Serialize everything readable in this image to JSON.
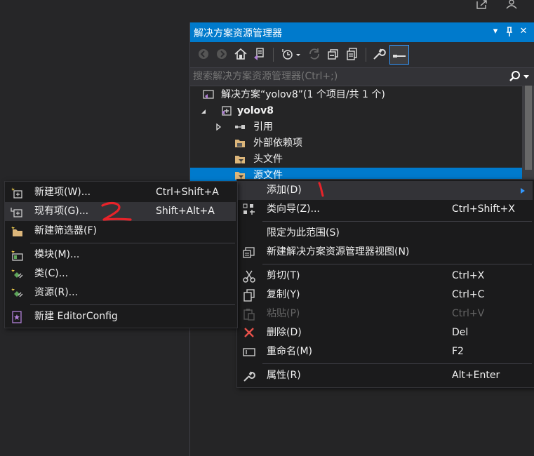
{
  "solution_explorer": {
    "title": "解决方案资源管理器",
    "title_buttons": [
      "▾",
      "⊥",
      "✕"
    ],
    "search_placeholder": "搜索解决方案资源管理器(Ctrl+;)",
    "tree": {
      "solution": "解决方案“yolov8”(1 个项目/共 1 个)",
      "project": "yolov8",
      "references": "引用",
      "external_deps": "外部依赖项",
      "header_files": "头文件",
      "source_files": "源文件"
    }
  },
  "context_menu": {
    "items": [
      {
        "label": "添加(D)",
        "shortcut": "",
        "icon": "none",
        "highlighted": true,
        "disabled": false,
        "has_submenu": true
      },
      {
        "label": "类向导(Z)...",
        "shortcut": "Ctrl+Shift+X",
        "icon": "class-wizard-icon",
        "disabled": false
      },
      {
        "label": "限定为此范围(S)",
        "shortcut": "",
        "icon": "none",
        "disabled": false
      },
      {
        "label": "新建解决方案资源管理器视图(N)",
        "shortcut": "",
        "icon": "new-view-icon",
        "disabled": false
      },
      {
        "label": "剪切(T)",
        "shortcut": "Ctrl+X",
        "icon": "scissors-icon",
        "disabled": false
      },
      {
        "label": "复制(Y)",
        "shortcut": "Ctrl+C",
        "icon": "copy-icon",
        "disabled": false
      },
      {
        "label": "粘贴(P)",
        "shortcut": "Ctrl+V",
        "icon": "paste-icon",
        "disabled": true
      },
      {
        "label": "删除(D)",
        "shortcut": "Del",
        "icon": "delete-icon",
        "disabled": false
      },
      {
        "label": "重命名(M)",
        "shortcut": "F2",
        "icon": "rename-icon",
        "disabled": false
      },
      {
        "label": "属性(R)",
        "shortcut": "Alt+Enter",
        "icon": "wrench-icon",
        "disabled": false
      }
    ]
  },
  "add_submenu": {
    "items": [
      {
        "label": "新建项(W)...",
        "shortcut": "Ctrl+Shift+A",
        "icon": "new-item-icon"
      },
      {
        "label": "现有项(G)...",
        "shortcut": "Shift+Alt+A",
        "icon": "existing-item-icon",
        "highlighted": true
      },
      {
        "label": "新建筛选器(F)",
        "shortcut": "",
        "icon": "new-filter-icon"
      },
      {
        "label": "模块(M)...",
        "shortcut": "",
        "icon": "module-icon"
      },
      {
        "label": "类(C)...",
        "shortcut": "",
        "icon": "class-icon"
      },
      {
        "label": "资源(R)...",
        "shortcut": "",
        "icon": "resource-icon"
      },
      {
        "label": "新建 EditorConfig",
        "shortcut": "",
        "icon": "editorconfig-icon"
      }
    ]
  },
  "annotations": {
    "mark_1": "1",
    "mark_2": "2",
    "color": "#e8232a"
  }
}
